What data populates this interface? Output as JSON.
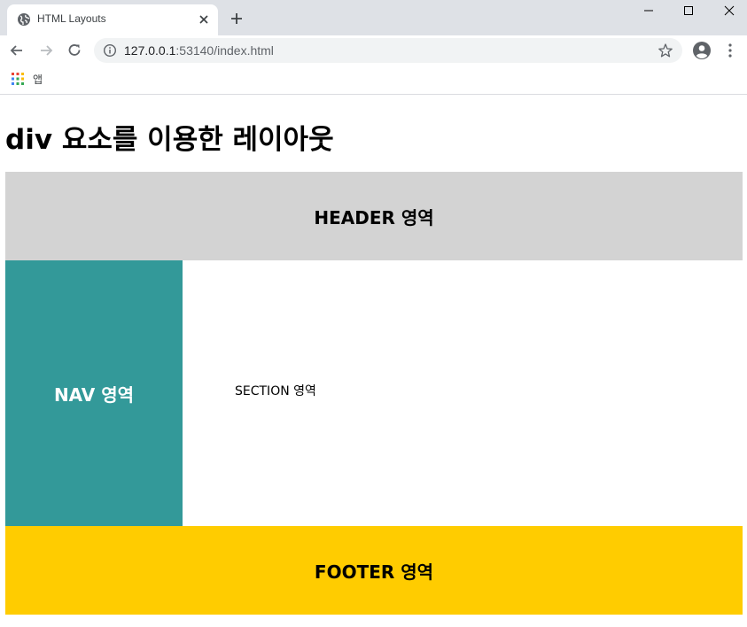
{
  "browser": {
    "tab_title": "HTML Layouts",
    "url_host": "127.0.0.1",
    "url_rest": ":53140/index.html",
    "bookmark_apps_label": "앱"
  },
  "page": {
    "title": "div 요소를 이용한 레이아웃",
    "header_label": "HEADER 영역",
    "nav_label": "NAV 영역",
    "section_label": "SECTION 영역",
    "footer_label": "FOOTER 영역"
  },
  "colors": {
    "header_bg": "#d3d3d3",
    "nav_bg": "#339999",
    "section_bg": "#ffffff",
    "footer_bg": "#ffcc00",
    "tabstrip_bg": "#dee1e6"
  }
}
